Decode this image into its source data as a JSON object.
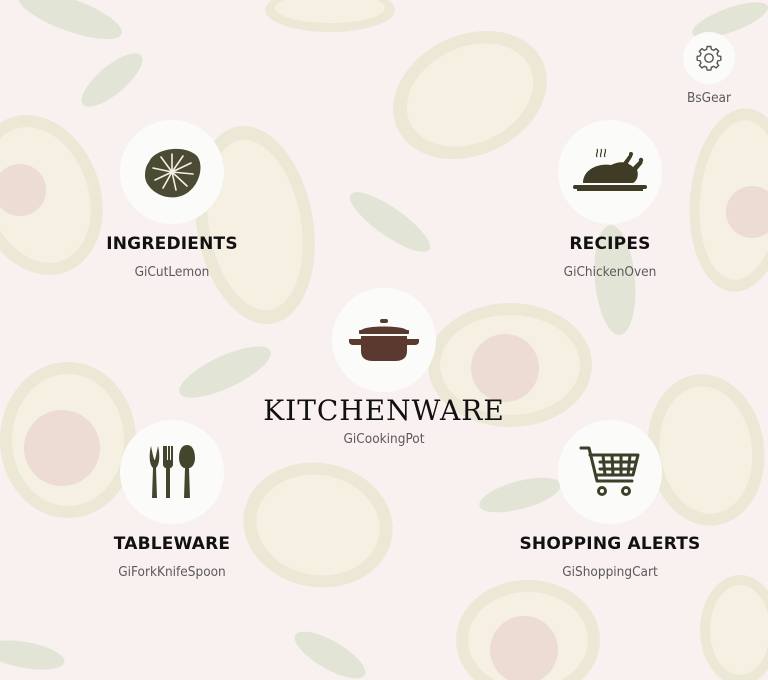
{
  "settings": {
    "label": "BsGear",
    "icon": "gear-icon"
  },
  "tiles": [
    {
      "title": "INGREDIENTS",
      "icon_name": "GiCutLemon",
      "icon": "cut-lemon-icon",
      "color": "#4b4a33"
    },
    {
      "title": "RECIPES",
      "icon_name": "GiChickenOven",
      "icon": "chicken-oven-icon",
      "color": "#3f3b24"
    },
    {
      "title": "KITCHENWARE",
      "icon_name": "GiCookingPot",
      "icon": "cooking-pot-icon",
      "color": "#5a3a2e"
    },
    {
      "title": "TABLEWARE",
      "icon_name": "GiForkKnifeSpoon",
      "icon": "fork-knife-spoon-icon",
      "color": "#45452d"
    },
    {
      "title": "SHOPPING ALERTS",
      "icon_name": "GiShoppingCart",
      "icon": "shopping-cart-icon",
      "color": "#3e3f28"
    }
  ]
}
